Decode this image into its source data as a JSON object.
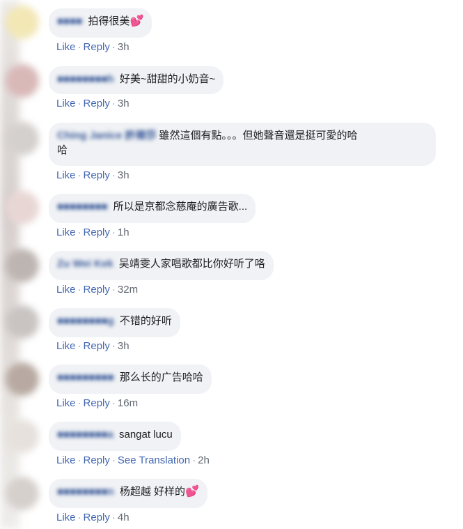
{
  "comments": [
    {
      "author": "■■■■",
      "text": "拍得很美",
      "heart": "💕",
      "time": "3h"
    },
    {
      "author": "■■■■■■■■h",
      "text": "好美~甜甜的小奶音~",
      "time": "3h"
    },
    {
      "author": "Ching Janice 許禕莎",
      "text_line1": "雖然這個有點。。。但她聲音還是挺可愛的哈",
      "text_line2": "哈",
      "time": "3h"
    },
    {
      "author": "■■■■■■■■",
      "text": "所以是京都念慈庵的廣告歌...",
      "time": "1h"
    },
    {
      "author": "Zu Wei Kek",
      "text": "吴靖雯人家唱歌都比你好听了咯",
      "time": "32m"
    },
    {
      "author": "■■■■■■■■g",
      "text": "不错的好听",
      "time": "3h"
    },
    {
      "author": "■■■■■■■■■",
      "text": "那么长的广告哈哈",
      "time": "16m"
    },
    {
      "author": "■■■■■■■■a",
      "text": "sangat lucu",
      "time": "2h",
      "see_translation": "See Translation"
    },
    {
      "author": "■■■■■■■■n",
      "text": "杨超越 好样的",
      "heart": "💕",
      "time": "4h"
    }
  ],
  "actions": {
    "like": "Like",
    "reply": "Reply",
    "dot": "·"
  },
  "colors": {
    "link": "#4267b2",
    "bubble": "#f0f2f5",
    "author": "#385898",
    "heart": "#e84a6a"
  }
}
